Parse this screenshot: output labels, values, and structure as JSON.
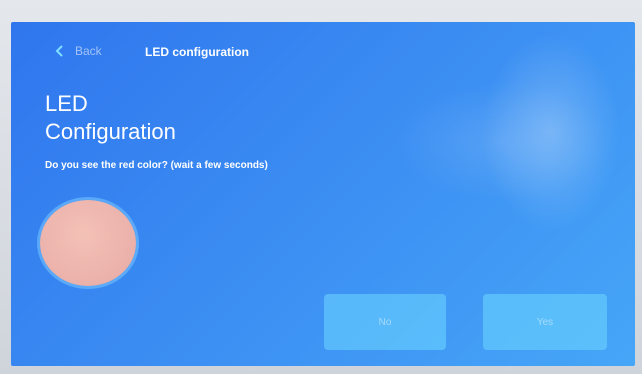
{
  "topbar": {
    "back_label": "Back",
    "title": "LED configuration"
  },
  "main": {
    "title_line1": "LED",
    "title_line2": "Configuration",
    "prompt": "Do you see the red color? (wait a few seconds)",
    "swatch_color": "#eab1aa"
  },
  "actions": {
    "no_label": "No",
    "yes_label": "Yes"
  },
  "colors": {
    "screen_background": "#3a8bf2",
    "button_background": "#6ed7ff"
  }
}
